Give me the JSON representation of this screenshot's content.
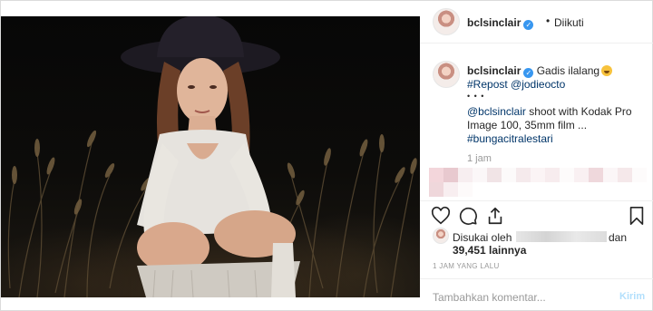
{
  "post": {
    "username": "bclsinclair",
    "dot": "•",
    "follow_status": "Diikuti",
    "caption": {
      "text": "Gadis ilalang",
      "repost": "#Repost @jodieocto",
      "dots": "• • •",
      "mention": "@bclsinclair",
      "line2": " shoot with Kodak Pro",
      "line3": "Image 100, 35mm film ...",
      "hashtag": "#bungacitralestari"
    },
    "time_ago": "1 jam",
    "likes": {
      "prefix": "Disukai oleh",
      "suffix": "dan",
      "count": "39,451 lainnya"
    },
    "timestamp": "1 JAM YANG LALU",
    "comment_placeholder": "Tambahkan komentar...",
    "send_label": "Kirim"
  },
  "icons": [
    "verified-badge-icon",
    "heart-icon",
    "comment-icon",
    "share-icon",
    "bookmark-icon",
    "laughing-emoji-icon"
  ],
  "colors": {
    "link": "#003569",
    "verified": "#3897f0",
    "send": "#b2dffc"
  }
}
